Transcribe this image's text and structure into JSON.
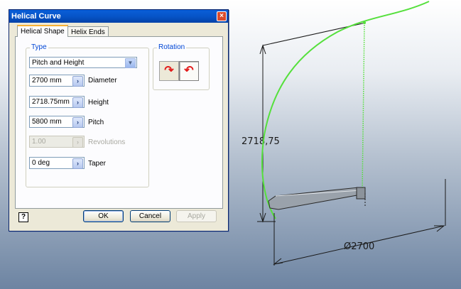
{
  "dialog": {
    "title": "Helical Curve",
    "close_glyph": "×",
    "tabs": [
      {
        "label": "Helical Shape",
        "active": true
      },
      {
        "label": "Helix Ends",
        "active": false
      }
    ],
    "type_group": {
      "label": "Type",
      "selected_type": "Pitch and Height"
    },
    "fields": {
      "diameter": {
        "value": "2700 mm",
        "label": "Diameter"
      },
      "height": {
        "value": "2718.75mm",
        "label": "Height"
      },
      "pitch": {
        "value": "5800 mm",
        "label": "Pitch"
      },
      "revolutions": {
        "value": "1.00",
        "label": "Revolutions",
        "enabled": false
      },
      "taper": {
        "value": "0 deg",
        "label": "Taper"
      }
    },
    "rotation_group": {
      "label": "Rotation",
      "clockwise_icon": "rotate-clockwise-icon",
      "counterclockwise_icon": "rotate-counterclockwise-icon",
      "selected": "counterclockwise"
    },
    "buttons": {
      "help_glyph": "?",
      "ok": "OK",
      "cancel": "Cancel",
      "apply": "Apply"
    }
  },
  "viewport": {
    "height_dimension": "2718,75",
    "diameter_dimension": "Ø2700",
    "colors": {
      "helix_curve": "#55e03c",
      "dimension_lines": "#1a1a1a",
      "accent_titlebar": "#0654c8"
    }
  }
}
